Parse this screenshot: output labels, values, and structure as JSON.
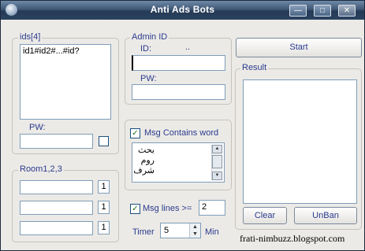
{
  "window": {
    "title": "Anti Ads Bots",
    "minimize": "—",
    "maximize": "□",
    "close": "✕"
  },
  "ids_group": {
    "label": "ids[4]",
    "textarea_value": "id1#id2#...#id?",
    "pw_label": "PW:",
    "pw_value": ""
  },
  "admin_group": {
    "label": "Admin ID",
    "id_label": "ID:",
    "id_dots": "..",
    "id_value": "",
    "pw_label": "PW:",
    "pw_value": ""
  },
  "start_button": "Start",
  "msg_word_group": {
    "checkbox_label": "Msg Contains word",
    "checked": true,
    "words": [
      "بحث",
      "روم",
      "شرف"
    ]
  },
  "room_group": {
    "label": "Room1,2,3",
    "rows": [
      {
        "value": "",
        "count": "1"
      },
      {
        "value": "",
        "count": "1"
      },
      {
        "value": "",
        "count": "1"
      }
    ]
  },
  "msg_lines": {
    "checkbox_label": "Msg lines >=",
    "checked": true,
    "value": "2"
  },
  "timer": {
    "label": "Timer",
    "value": "5",
    "unit": "Min"
  },
  "result_group": {
    "label": "Result",
    "clear_button": "Clear",
    "unban_button": "UnBan"
  },
  "footer_text": "frati-nimbuzz.blogspot.com",
  "icons": {
    "app": "globe-icon",
    "check": "checkmark-icon",
    "spin": "spinner-arrows-icon"
  },
  "colors": {
    "label_text": "#2a3b8f",
    "titlebar": "#2a4260",
    "face": "#eceae6",
    "field_border": "#7f9db9"
  }
}
